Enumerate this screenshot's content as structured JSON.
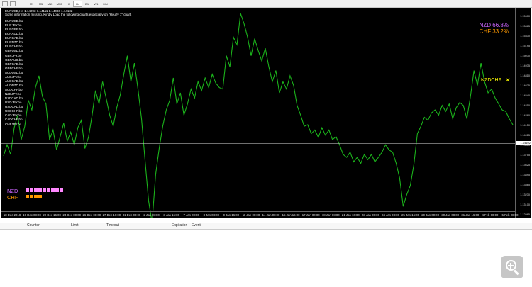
{
  "toolbar": {
    "timeframes": [
      "M1",
      "M5",
      "M15",
      "M30",
      "H1",
      "H4",
      "D1",
      "W1",
      "MN"
    ],
    "active": "H4"
  },
  "chart": {
    "header": "EURUSD,H4  1.14093 1.14111 1.14086 1.14102",
    "notice": "Some information missing. Kindly Load the following charts especially on \"Hourly 1\" chart.",
    "symbols": [
      "EURUSD.bo",
      "EURJPY.bo",
      "EURGBP.bo",
      "EURAUD.bo",
      "EURCAD.bo",
      "EURNZD.bo",
      "EURCHF.bo",
      "GBPUSD.bo",
      "GBPJPY.bo",
      "GBPAUD.bo",
      "GBPCAD.bo",
      "GBPCHF.bo",
      "AUDUSD.bo",
      "AUDJPY.bo",
      "AUDCAD.bo",
      "AUDNZD.bo",
      "AUDCHF.bo",
      "NZDJPY.bo",
      "NZDCAD.bo",
      "USDJPY.bo",
      "USDCAD.bo",
      "USDCHF.bo",
      "CADJPY.bo",
      "CADCHF.bo",
      "CHFJPY.bo"
    ],
    "strength": {
      "nzd": "NZD  66.8%",
      "chf": "CHF  33.2%",
      "nzd_color": "#cc66ff",
      "chf_color": "#ff9900",
      "nzd_bars": 9,
      "chf_bars": 4
    },
    "pair": "NZDCHF",
    "pair_close": "✕",
    "ccy_nzd": "NZD",
    "ccy_chf": "CHF",
    "current_price": "1.14102",
    "price_axis": [
      "1.15600",
      "1.15465",
      "1.15330",
      "1.15195",
      "1.15070",
      "1.14935",
      "1.14810",
      "1.14675",
      "1.14540",
      "1.14410",
      "1.14280",
      "1.14150",
      "1.14015",
      "1.13885",
      "1.13755",
      "1.13625",
      "1.13495",
      "1.13365",
      "1.13230",
      "1.13100",
      "1.12965"
    ],
    "time_axis": [
      "18 Dec 2018",
      "19 Dec 08:00",
      "20 Dec 16:00",
      "24 Dec 00:00",
      "26 Dec 08:00",
      "27 Dec 16:00",
      "31 Dec 00:00",
      "2 Jan 08:00",
      "3 Jan 16:00",
      "7 Jan 00:00",
      "8 Jan 08:00",
      "9 Jan 16:00",
      "11 Jan 00:00",
      "14 Jan 08:00",
      "15 Jan 16:00",
      "17 Jan 00:00",
      "18 Jan 08:00",
      "21 Jan 16:00",
      "23 Jan 00:00",
      "24 Jan 08:00",
      "25 Jan 16:00",
      "29 Jan 00:00",
      "30 Jan 08:00",
      "31 Jan 16:00",
      "4 Feb 00:00",
      "5 Feb 08:00"
    ]
  },
  "terminal": {
    "columns": [
      "Counter",
      "Limit",
      "Timeout",
      "Expiration",
      "Event"
    ]
  },
  "chart_data": {
    "type": "line",
    "title": "EURUSD,H4",
    "series": [
      {
        "values": [
          1.137,
          1.1385,
          1.1372,
          1.1408,
          1.1425,
          1.1392,
          1.141,
          1.1445,
          1.1432,
          1.1462,
          1.1478,
          1.145,
          1.144,
          1.1392,
          1.1405,
          1.1378,
          1.1396,
          1.1414,
          1.139,
          1.1402,
          1.1385,
          1.1408,
          1.1418,
          1.138,
          1.1395,
          1.1424,
          1.1458,
          1.144,
          1.147,
          1.1448,
          1.1425,
          1.141,
          1.1435,
          1.1452,
          1.148,
          1.1505,
          1.147,
          1.1495,
          1.146,
          1.142,
          1.1365,
          1.131,
          1.128,
          1.1345,
          1.138,
          1.141,
          1.1432,
          1.1445,
          1.1475,
          1.144,
          1.1455,
          1.1425,
          1.144,
          1.146,
          1.1448,
          1.147,
          1.1458,
          1.1475,
          1.1462,
          1.148,
          1.1468,
          1.1462,
          1.146,
          1.1505,
          1.149,
          1.153,
          1.152,
          1.1562,
          1.1548,
          1.153,
          1.1505,
          1.1528,
          1.1512,
          1.1498,
          1.1515,
          1.149,
          1.147,
          1.1485,
          1.1455,
          1.147,
          1.146,
          1.1478,
          1.1465,
          1.1438,
          1.1425,
          1.141,
          1.1412,
          1.14,
          1.1405,
          1.1395,
          1.1408,
          1.1398,
          1.1405,
          1.1392,
          1.1396,
          1.1385,
          1.1372,
          1.1368,
          1.1375,
          1.1362,
          1.1368,
          1.136,
          1.1372,
          1.1365,
          1.1372,
          1.1362,
          1.1368,
          1.1375,
          1.1385,
          1.1378,
          1.1375,
          1.136,
          1.134,
          1.1302,
          1.1318,
          1.133,
          1.1358,
          1.14,
          1.141,
          1.1422,
          1.1418,
          1.1428,
          1.1432,
          1.1425,
          1.1438,
          1.143,
          1.144,
          1.142,
          1.1435,
          1.1442,
          1.1438,
          1.142,
          1.145,
          1.1485,
          1.1465,
          1.1495,
          1.147,
          1.1455,
          1.146,
          1.1448,
          1.144,
          1.1432,
          1.143,
          1.142,
          1.1412
        ]
      }
    ],
    "ylim": [
      1.12965,
      1.156
    ]
  }
}
